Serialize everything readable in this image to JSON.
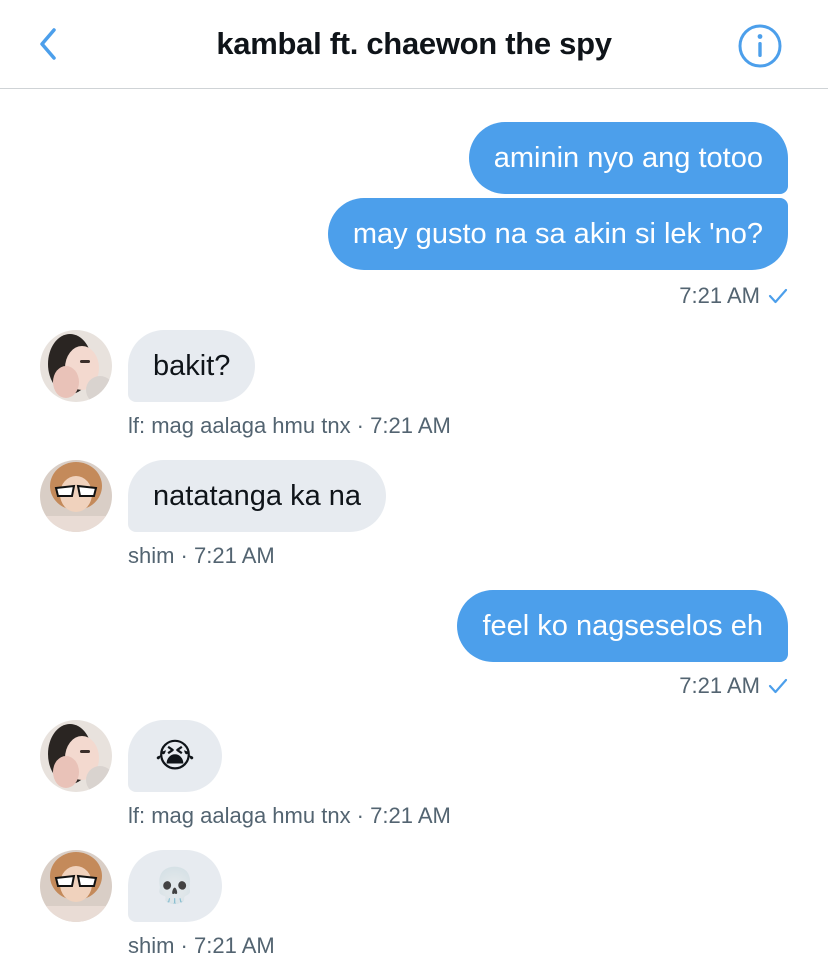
{
  "header": {
    "title": "kambal ft. chaewon the spy",
    "back_icon": "chevron-left-icon",
    "info_icon": "info-circle-icon",
    "accent_color": "#4c9feb"
  },
  "messages": [
    {
      "text": "aminin nyo ang totoo"
    },
    {
      "text": "may gusto na sa akin si lek 'no?"
    },
    {
      "meta": "7:21 AM"
    },
    {
      "text": "bakit?"
    },
    {
      "meta": "lf: mag aalaga hmu tnx · 7:21 AM"
    },
    {
      "text": "natatanga ka na"
    },
    {
      "meta": "shim · 7:21 AM"
    },
    {
      "text": "feel ko nagseselos eh"
    },
    {
      "meta": "7:21 AM"
    },
    {
      "text": "😭"
    },
    {
      "meta": "lf: mag aalaga hmu tnx · 7:21 AM"
    },
    {
      "text": "💀"
    },
    {
      "meta": "shim · 7:21 AM"
    }
  ],
  "colors": {
    "outgoing_bubble": "#4c9feb",
    "incoming_bubble": "#e7ebf0",
    "meta_text": "#536471"
  }
}
